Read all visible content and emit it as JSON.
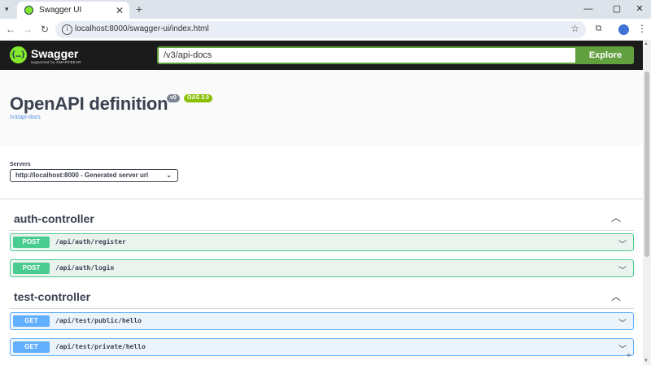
{
  "browser": {
    "tab_title": "Swagger UI",
    "close_glyph": "✕",
    "newtab_glyph": "+",
    "url": "localhost:8000/swagger-ui/index.html"
  },
  "swagger": {
    "brand": "Swagger",
    "brand_sub": "supported by SMARTBEAR",
    "spec_url": "/v3/api-docs",
    "explore_label": "Explore"
  },
  "info": {
    "title": "OpenAPI definition",
    "version_badge": "v0",
    "oas_badge": "OAS 3.0",
    "spec_link": "/v3/api-docs"
  },
  "servers": {
    "label": "Servers",
    "selected": "http://localhost:8000 - Generated server url"
  },
  "sections": [
    {
      "name": "auth-controller",
      "operations": [
        {
          "method": "POST",
          "path": "/api/auth/register"
        },
        {
          "method": "POST",
          "path": "/api/auth/login"
        }
      ]
    },
    {
      "name": "test-controller",
      "operations": [
        {
          "method": "GET",
          "path": "/api/test/public/hello"
        },
        {
          "method": "GET",
          "path": "/api/test/private/hello"
        }
      ]
    }
  ],
  "colors": {
    "post": "#49cc90",
    "get": "#61affe",
    "explore": "#62a03f",
    "topbar": "#1b1b1b"
  },
  "icons": [
    "swagger-logo-icon",
    "back-icon",
    "forward-icon",
    "reload-icon",
    "site-info-icon",
    "bookmark-star-icon",
    "extensions-icon",
    "profile-icon",
    "menu-icon",
    "chevron-up-icon",
    "chevron-down-icon"
  ]
}
